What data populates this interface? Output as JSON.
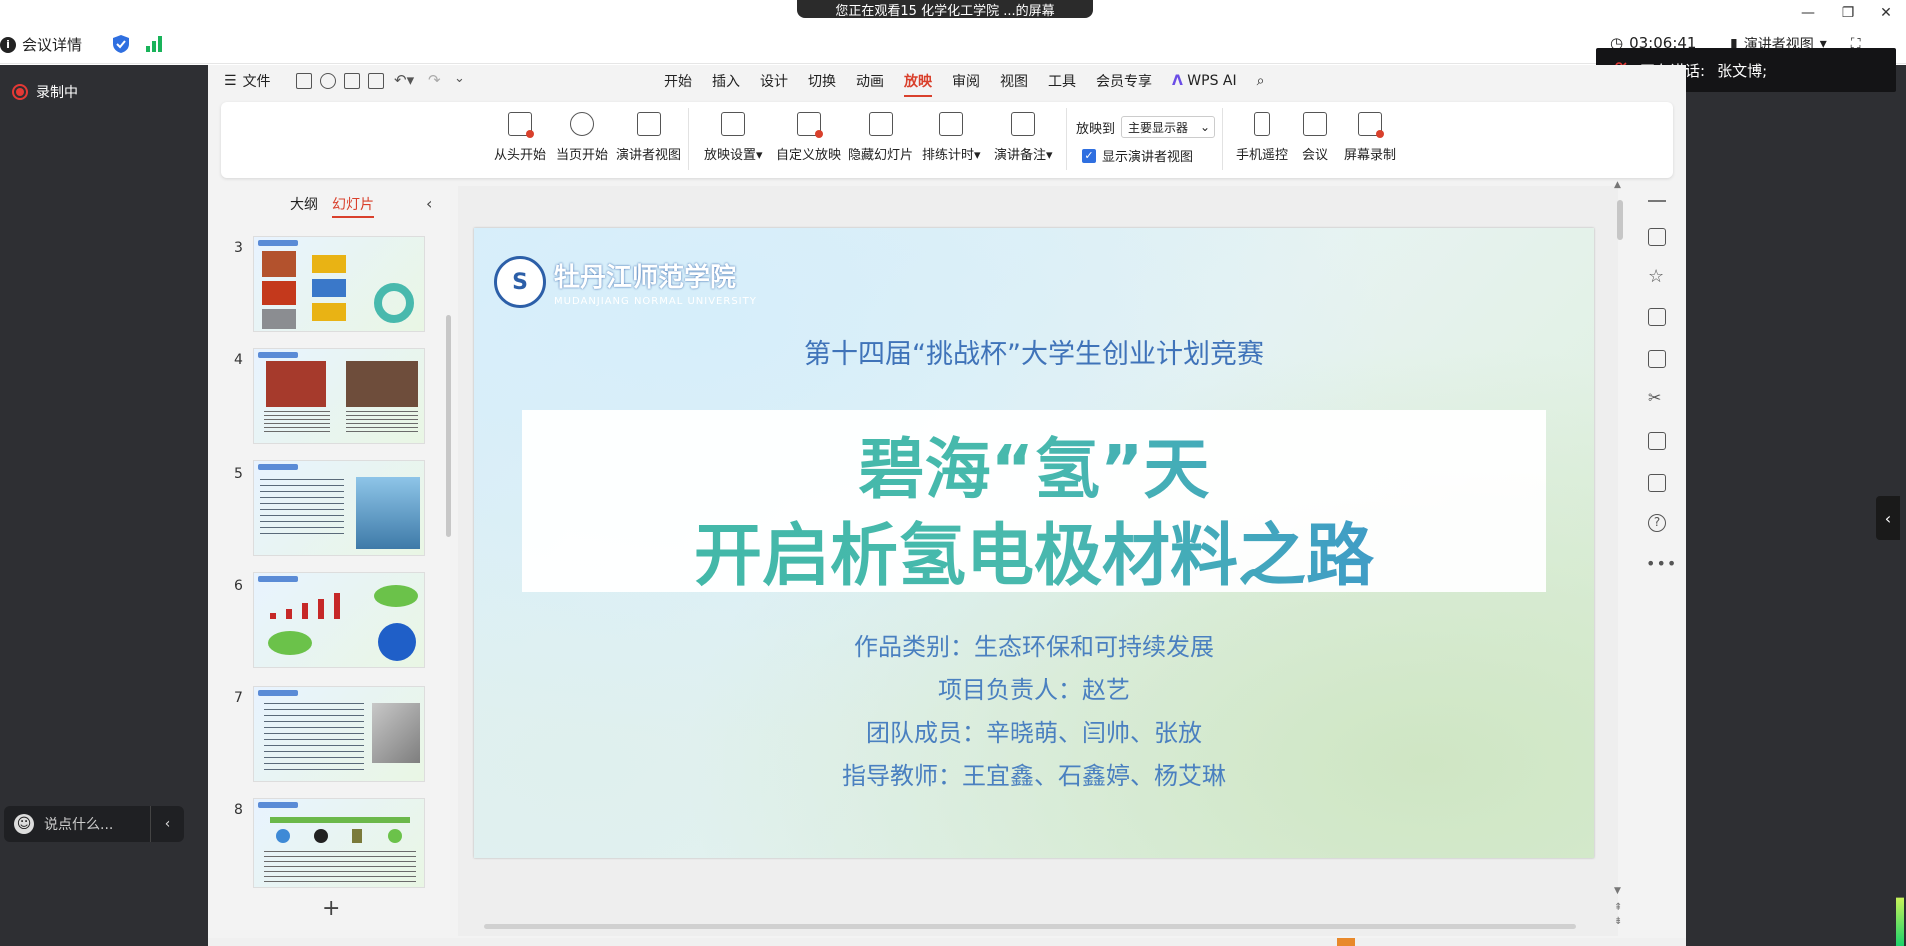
{
  "share_banner": "您正在观看15 化学化工学院 ...的屏幕",
  "meeting": {
    "info_label": "会议详情",
    "timer": "03:06:41",
    "presenter_view": "演讲者视图",
    "recording": "录制中",
    "speaking_label": "正在讲话:",
    "speaker": "张文博;",
    "chat_placeholder": "说点什么..."
  },
  "menu": {
    "file": "文件",
    "tabs": [
      "开始",
      "插入",
      "设计",
      "切换",
      "动画",
      "放映",
      "审阅",
      "视图",
      "工具",
      "会员专享"
    ],
    "active_tab": "放映",
    "wps_ai": "WPS AI"
  },
  "ribbon": {
    "from_start": "从头开始",
    "current_start": "当页开始",
    "presenter_view": "演讲者视图",
    "slideshow_settings": "放映设置",
    "custom_show": "自定义放映",
    "hide_slide": "隐藏幻灯片",
    "rehearse": "排练计时",
    "speaker_notes": "演讲备注",
    "play_to_label": "放映到",
    "play_to_value": "主要显示器",
    "show_presenter_view": "显示演讲者视图",
    "phone_remote": "手机遥控",
    "meeting": "会议",
    "screen_record": "屏幕录制"
  },
  "thumbnails": {
    "tab_outline": "大纲",
    "tab_slides": "幻灯片",
    "numbers": [
      "3",
      "4",
      "5",
      "6",
      "7",
      "8"
    ]
  },
  "slide": {
    "school_cn": "牡丹江师范学院",
    "school_en": "MUDANJIANG NORMAL UNIVERSITY",
    "competition": "第十四届“挑战杯”大学生创业计划竞赛",
    "title_line1": "碧海“氢”天",
    "title_line2": "开启析氢电极材料之路",
    "category": "作品类别：生态环保和可持续发展",
    "leader": "项目负责人：赵艺",
    "team": "团队成员：辛晓萌、闫帅、张放",
    "advisors": "指导教师：王宜鑫、石鑫婷、杨艾琳"
  },
  "colors": {
    "accent_red": "#d9402c",
    "title_teal": "#3fb8a6",
    "title_blue": "#3a8ad6",
    "info_blue": "#4a80c0",
    "record_red": "#e53935"
  }
}
